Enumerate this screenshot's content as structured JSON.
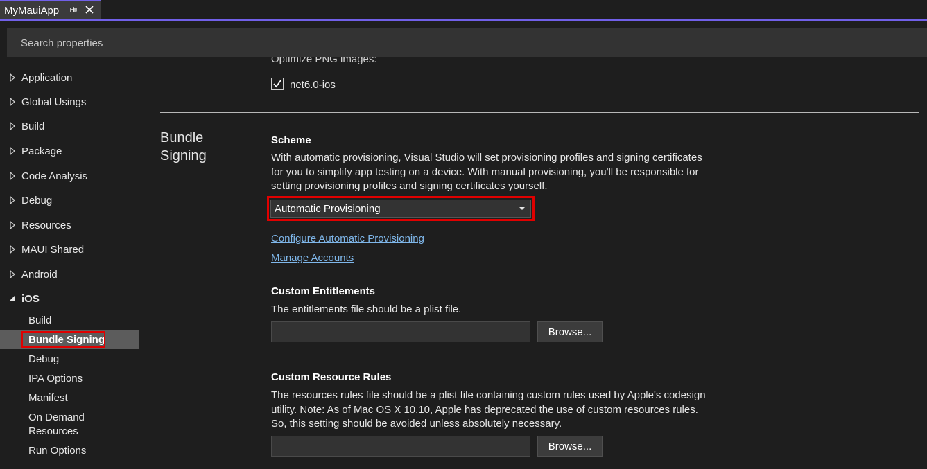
{
  "tab": {
    "title": "MyMauiApp",
    "pin_icon": "pin-icon",
    "close_icon": "close-icon"
  },
  "search": {
    "placeholder": "Search properties"
  },
  "sidebar": {
    "items": [
      {
        "label": "Application"
      },
      {
        "label": "Global Usings"
      },
      {
        "label": "Build"
      },
      {
        "label": "Package"
      },
      {
        "label": "Code Analysis"
      },
      {
        "label": "Debug"
      },
      {
        "label": "Resources"
      },
      {
        "label": "MAUI Shared"
      },
      {
        "label": "Android"
      },
      {
        "label": "iOS"
      }
    ],
    "ios_children": [
      {
        "label": "Build"
      },
      {
        "label": "Bundle Signing"
      },
      {
        "label": "Debug"
      },
      {
        "label": "IPA Options"
      },
      {
        "label": "Manifest"
      },
      {
        "label": "On Demand Resources"
      },
      {
        "label": "Run Options"
      }
    ],
    "selected": "Bundle Signing"
  },
  "main": {
    "prev_section": {
      "cut_label": "Optimize PNG images:",
      "checkbox_label": "net6.0-ios",
      "checked": true
    },
    "section_title": "Bundle Signing",
    "scheme": {
      "heading": "Scheme",
      "description": "With automatic provisioning, Visual Studio will set provisioning profiles and signing certificates for you to simplify app testing on a device. With manual provisioning, you'll be responsible for setting provisioning profiles and signing certificates yourself.",
      "selected": "Automatic Provisioning",
      "link_configure": "Configure Automatic Provisioning",
      "link_accounts": "Manage Accounts"
    },
    "entitlements": {
      "heading": "Custom Entitlements",
      "description": "The entitlements file should be a plist file.",
      "value": "",
      "browse_label": "Browse..."
    },
    "resource_rules": {
      "heading": "Custom Resource Rules",
      "description": "The resources rules file should be a plist file containing custom rules used by Apple's codesign utility. Note: As of Mac OS X 10.10, Apple has deprecated the use of custom resources rules. So, this setting should be avoided unless absolutely necessary.",
      "value": "",
      "browse_label": "Browse..."
    }
  },
  "colors": {
    "accent": "#7160e8",
    "highlight": "#e00000",
    "link": "#7fb7ea"
  }
}
